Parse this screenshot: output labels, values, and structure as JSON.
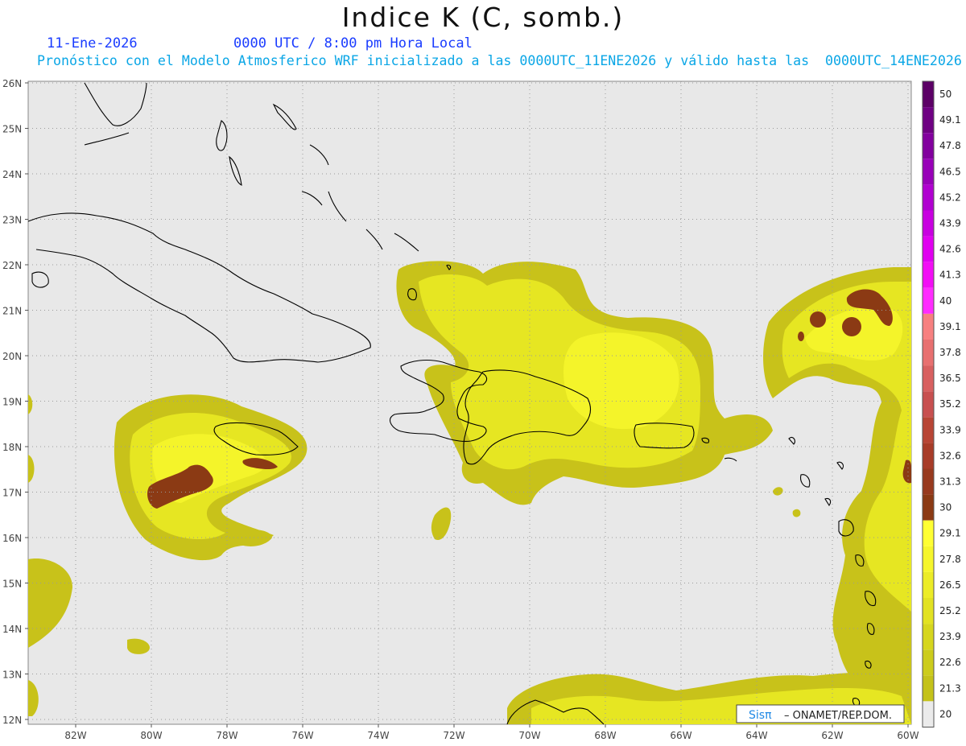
{
  "header": {
    "title": "Indice K (C, somb.)",
    "date": "11-Ene-2026",
    "time": "0000 UTC / 8:00 pm Hora Local",
    "run": "Pronóstico con el Modelo Atmosferico WRF inicializado a las 0000UTC_11ENE2026 y válido hasta las  0000UTC_14ENE2026"
  },
  "axes": {
    "lat_labels": [
      "26N",
      "25N",
      "24N",
      "23N",
      "22N",
      "21N",
      "20N",
      "19N",
      "18N",
      "17N",
      "16N",
      "15N",
      "14N",
      "13N",
      "12N"
    ],
    "lon_labels": [
      "82W",
      "80W",
      "78W",
      "76W",
      "74W",
      "72W",
      "70W",
      "68W",
      "66W",
      "64W",
      "62W",
      "60W"
    ]
  },
  "colorbar": {
    "labels": [
      "50",
      "49.1",
      "47.8",
      "46.5",
      "45.2",
      "43.9",
      "42.6",
      "41.3",
      "40",
      "39.1",
      "37.8",
      "36.5",
      "35.2",
      "33.9",
      "32.6",
      "31.3",
      "30",
      "29.1",
      "27.8",
      "26.5",
      "25.2",
      "23.9",
      "22.6",
      "21.3",
      "20"
    ]
  },
  "credit": {
    "logo": "Sisπ",
    "text": "– ONAMET/REP.DOM."
  },
  "colors": {
    "ocean": "#e8e8e8",
    "low": "#c8c21a",
    "mid": "#e6e622",
    "high": "#f4f42a",
    "storm": "#8b3a14",
    "title_blue": "#1a3cff",
    "run_blue": "#0aa6e6"
  }
}
